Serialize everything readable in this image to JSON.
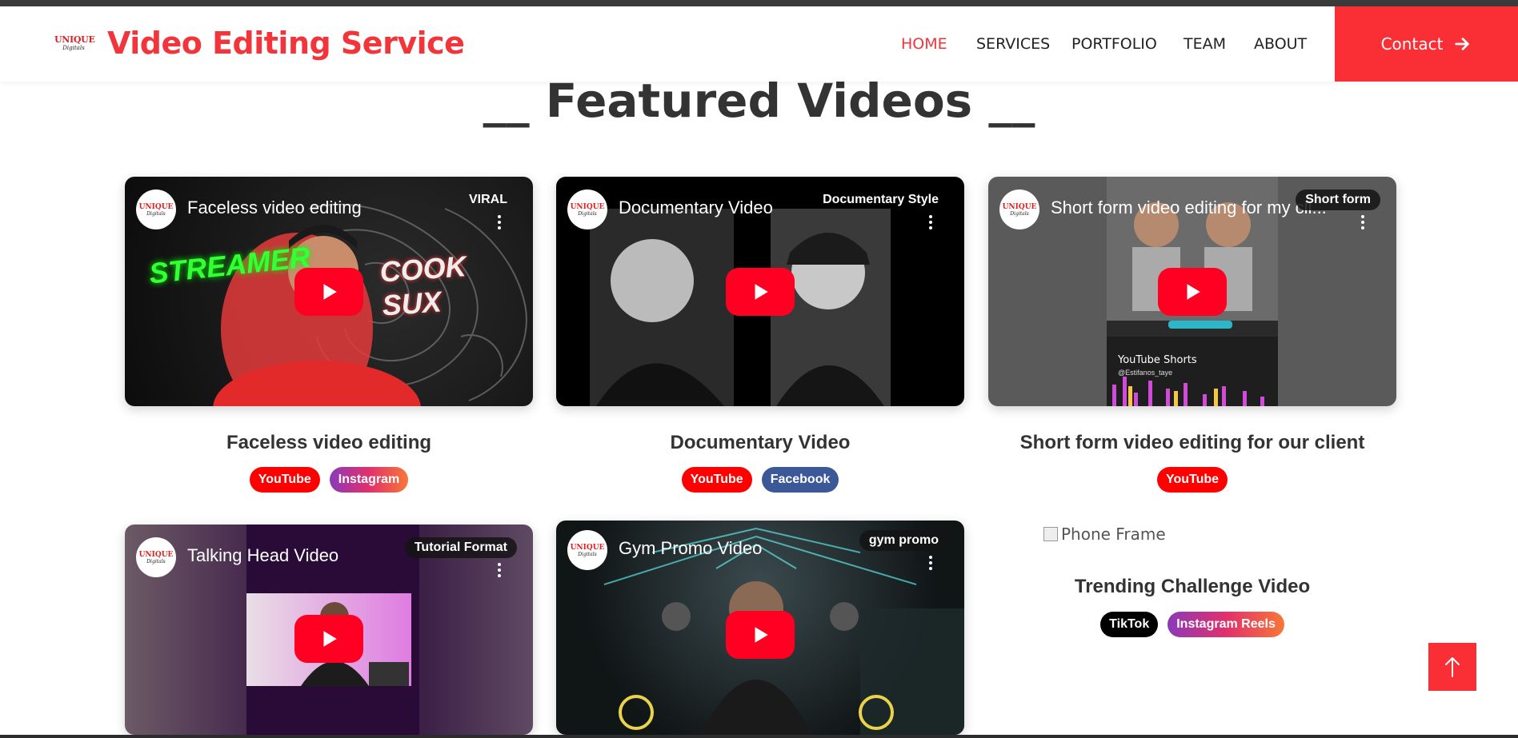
{
  "header": {
    "logo_top": "UNIQUE",
    "logo_bottom": "Digitals",
    "brand": "Video Editing Service",
    "nav": [
      {
        "label": "HOME",
        "active": true
      },
      {
        "label": "SERVICES",
        "active": false
      },
      {
        "label": "PORTFOLIO",
        "active": false
      },
      {
        "label": "TEAM",
        "active": false
      },
      {
        "label": "ABOUT",
        "active": false
      }
    ],
    "contact_label": "Contact"
  },
  "section": {
    "title": "__ Featured Videos __"
  },
  "videos": [
    {
      "channel_top": "UNIQUE",
      "channel_bottom": "Digitals",
      "player_title": "Faceless video editing",
      "tag": "VIRAL",
      "caption": "Faceless video editing",
      "platforms": [
        "YouTube",
        "Instagram"
      ]
    },
    {
      "channel_top": "UNIQUE",
      "channel_bottom": "Digitals",
      "player_title": "Documentary Video",
      "tag": "Documentary Style",
      "caption": "Documentary Video",
      "platforms": [
        "YouTube",
        "Facebook"
      ]
    },
    {
      "channel_top": "UNIQUE",
      "channel_bottom": "Digitals",
      "player_title": "Short form video editing for my cli...",
      "tag": "Short form",
      "caption": "Short form video editing for our client",
      "platforms": [
        "YouTube"
      ],
      "thumb_text": "YouTube Shorts",
      "thumb_handle": "@Estifanos_taye"
    },
    {
      "channel_top": "UNIQUE",
      "channel_bottom": "Digitals",
      "player_title": "Talking Head Video",
      "tag": "Tutorial Format"
    },
    {
      "channel_top": "UNIQUE",
      "channel_bottom": "Digitals",
      "player_title": "Gym Promo Video",
      "tag": "gym promo"
    }
  ],
  "phone_card": {
    "alt_text": "Phone Frame",
    "caption": "Trending Challenge Video",
    "platforms": [
      "TikTok",
      "Instagram Reels"
    ]
  },
  "thumb1_words": [
    "STREAMER",
    "COOK SUX"
  ],
  "colors": {
    "accent": "#fa2e35",
    "brand_text": "#f2353a",
    "youtube": "#ff0000",
    "facebook": "#3b5998",
    "tiktok": "#000000"
  },
  "icons": {
    "contact": "arrow-right-icon",
    "scroll_top": "arrow-up-icon",
    "play": "play-icon"
  }
}
